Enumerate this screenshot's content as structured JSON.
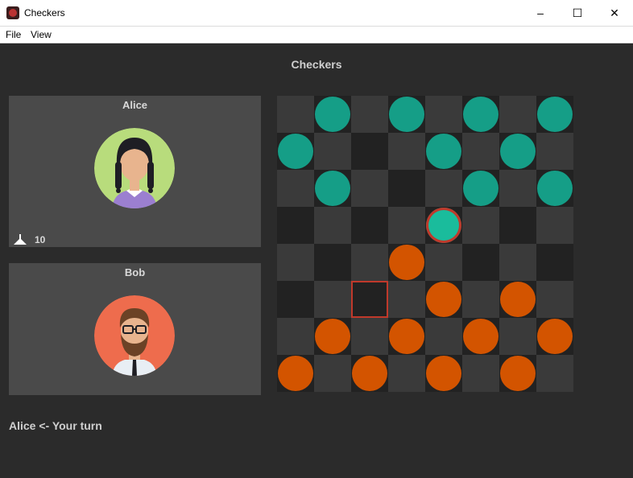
{
  "window": {
    "title": "Checkers",
    "minimize_icon": "–",
    "maximize_icon": "☐",
    "close_icon": "✕"
  },
  "menu": {
    "items": [
      "File",
      "View"
    ]
  },
  "heading": "Checkers",
  "players": [
    {
      "name": "Alice",
      "pieces_left": "10",
      "avatar_bg": "#b8dc7c"
    },
    {
      "name": "Bob",
      "avatar_bg": "#ee6c4d"
    }
  ],
  "status": "Alice  <- Your turn",
  "colors": {
    "teal": "#159e87",
    "orange": "#d35400",
    "selected": "#1abc9c",
    "highlight": "#c0392b"
  },
  "board": {
    "rows": [
      [
        "",
        "T",
        "",
        "T",
        "",
        "T",
        "",
        "T"
      ],
      [
        "T",
        "",
        "",
        "",
        "T",
        "",
        "T",
        ""
      ],
      [
        "",
        "T",
        "",
        "",
        "",
        "T",
        "",
        "T"
      ],
      [
        "",
        "",
        "",
        "",
        "S",
        "",
        "",
        ""
      ],
      [
        "",
        "",
        "",
        "O",
        "",
        "",
        "",
        ""
      ],
      [
        "",
        "",
        "X",
        "",
        "O",
        "",
        "O",
        ""
      ],
      [
        "",
        "O",
        "",
        "O",
        "",
        "O",
        "",
        "O"
      ],
      [
        "O",
        "",
        "O",
        "",
        "O",
        "",
        "O",
        ""
      ]
    ]
  }
}
